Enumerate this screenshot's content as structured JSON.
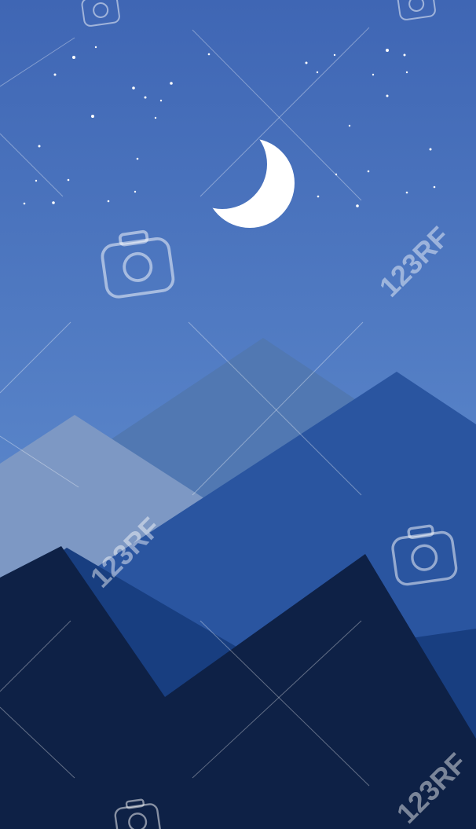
{
  "scene": {
    "subject": "night-mountain-landscape",
    "colors": {
      "sky_top": "#3f66b4",
      "sky_bottom": "#6b9ad8",
      "moon": "#ffffff",
      "star": "#ffffff",
      "mountain_back": "#5178b2",
      "mountain_left_pale": "#7d98c4",
      "mountain_mid": "#2a55a0",
      "mountain_shadow": "#183e80",
      "mountain_front": "#0e2146"
    },
    "icons": [
      "crescent-moon-icon",
      "star-icon",
      "camera-watermark-icon"
    ]
  },
  "watermark": {
    "text": "123RF"
  }
}
